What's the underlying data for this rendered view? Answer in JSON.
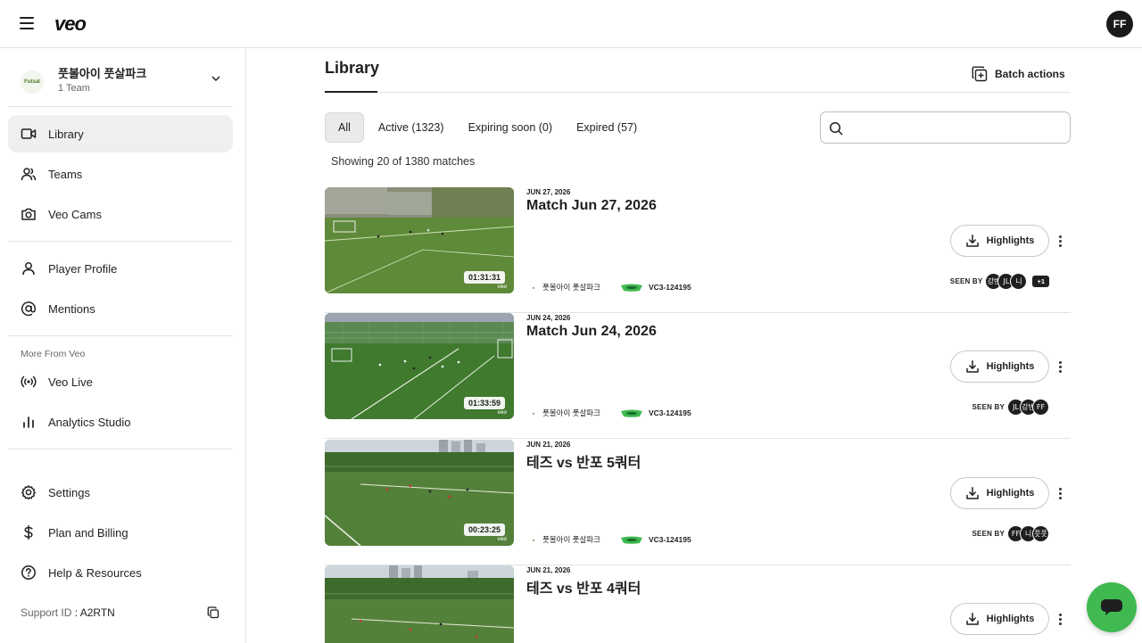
{
  "app": {
    "logo": "veo",
    "user_initials": "FF"
  },
  "sidebar": {
    "org_name": "풋볼아이 풋살파크",
    "org_sub": "1 Team",
    "org_logo_text": "Futsal",
    "items_main": [
      {
        "label": "Library",
        "icon": "video-camera-icon"
      },
      {
        "label": "Teams",
        "icon": "users-icon"
      },
      {
        "label": "Veo Cams",
        "icon": "camera-icon"
      }
    ],
    "items_profile": [
      {
        "label": "Player Profile",
        "icon": "user-icon"
      },
      {
        "label": "Mentions",
        "icon": "at-sign-icon"
      }
    ],
    "more_from": "More From Veo",
    "items_more": [
      {
        "label": "Veo Live",
        "icon": "broadcast-icon"
      },
      {
        "label": "Analytics Studio",
        "icon": "bar-chart-icon"
      }
    ],
    "items_bottom": [
      {
        "label": "Settings",
        "icon": "gear-icon"
      },
      {
        "label": "Plan and Billing",
        "icon": "dollar-icon"
      },
      {
        "label": "Help & Resources",
        "icon": "help-circle-icon"
      }
    ],
    "support_label": "Support ID",
    "support_sep": " : ",
    "support_id": "A2RTN"
  },
  "main": {
    "title": "Library",
    "batch_label": "Batch actions",
    "tabs": [
      {
        "label": "All",
        "active": true
      },
      {
        "label": "Active (1323)",
        "active": false
      },
      {
        "label": "Expiring soon (0)",
        "active": false
      },
      {
        "label": "Expired (57)",
        "active": false
      }
    ],
    "search_placeholder": "",
    "showing": "Showing 20 of 1380 matches",
    "highlights_label": "Highlights",
    "seen_by_label": "SEEN BY",
    "matches": [
      {
        "date": "JUN 27, 2026",
        "title": "Match Jun 27, 2026",
        "duration": "01:31:31",
        "club": "풋볼아이 풋살파크",
        "camera": "VC3-124195",
        "seen_by": [
          "강빈",
          "JL",
          "니"
        ],
        "seen_more": "+1"
      },
      {
        "date": "JUN 24, 2026",
        "title": "Match Jun 24, 2026",
        "duration": "01:33:59",
        "club": "풋볼아이 풋살파크",
        "camera": "VC3-124195",
        "seen_by": [
          "JL",
          "강빈",
          "FF"
        ],
        "seen_more": ""
      },
      {
        "date": "JUN 21, 2026",
        "title": "테즈 vs 반포 5쿼터",
        "duration": "00:23:25",
        "club": "풋볼아이 풋살파크",
        "camera": "VC3-124195",
        "seen_by": [
          "FF",
          "니",
          "풋풋"
        ],
        "seen_more": ""
      },
      {
        "date": "JUN 21, 2026",
        "title": "테즈 vs 반포 4쿼터",
        "duration": "",
        "club": "",
        "camera": "",
        "seen_by": [],
        "seen_more": ""
      }
    ]
  },
  "colors": {
    "accent_green": "#3fb950",
    "active_bg": "#efefef",
    "pitch": "#4d7a35"
  }
}
